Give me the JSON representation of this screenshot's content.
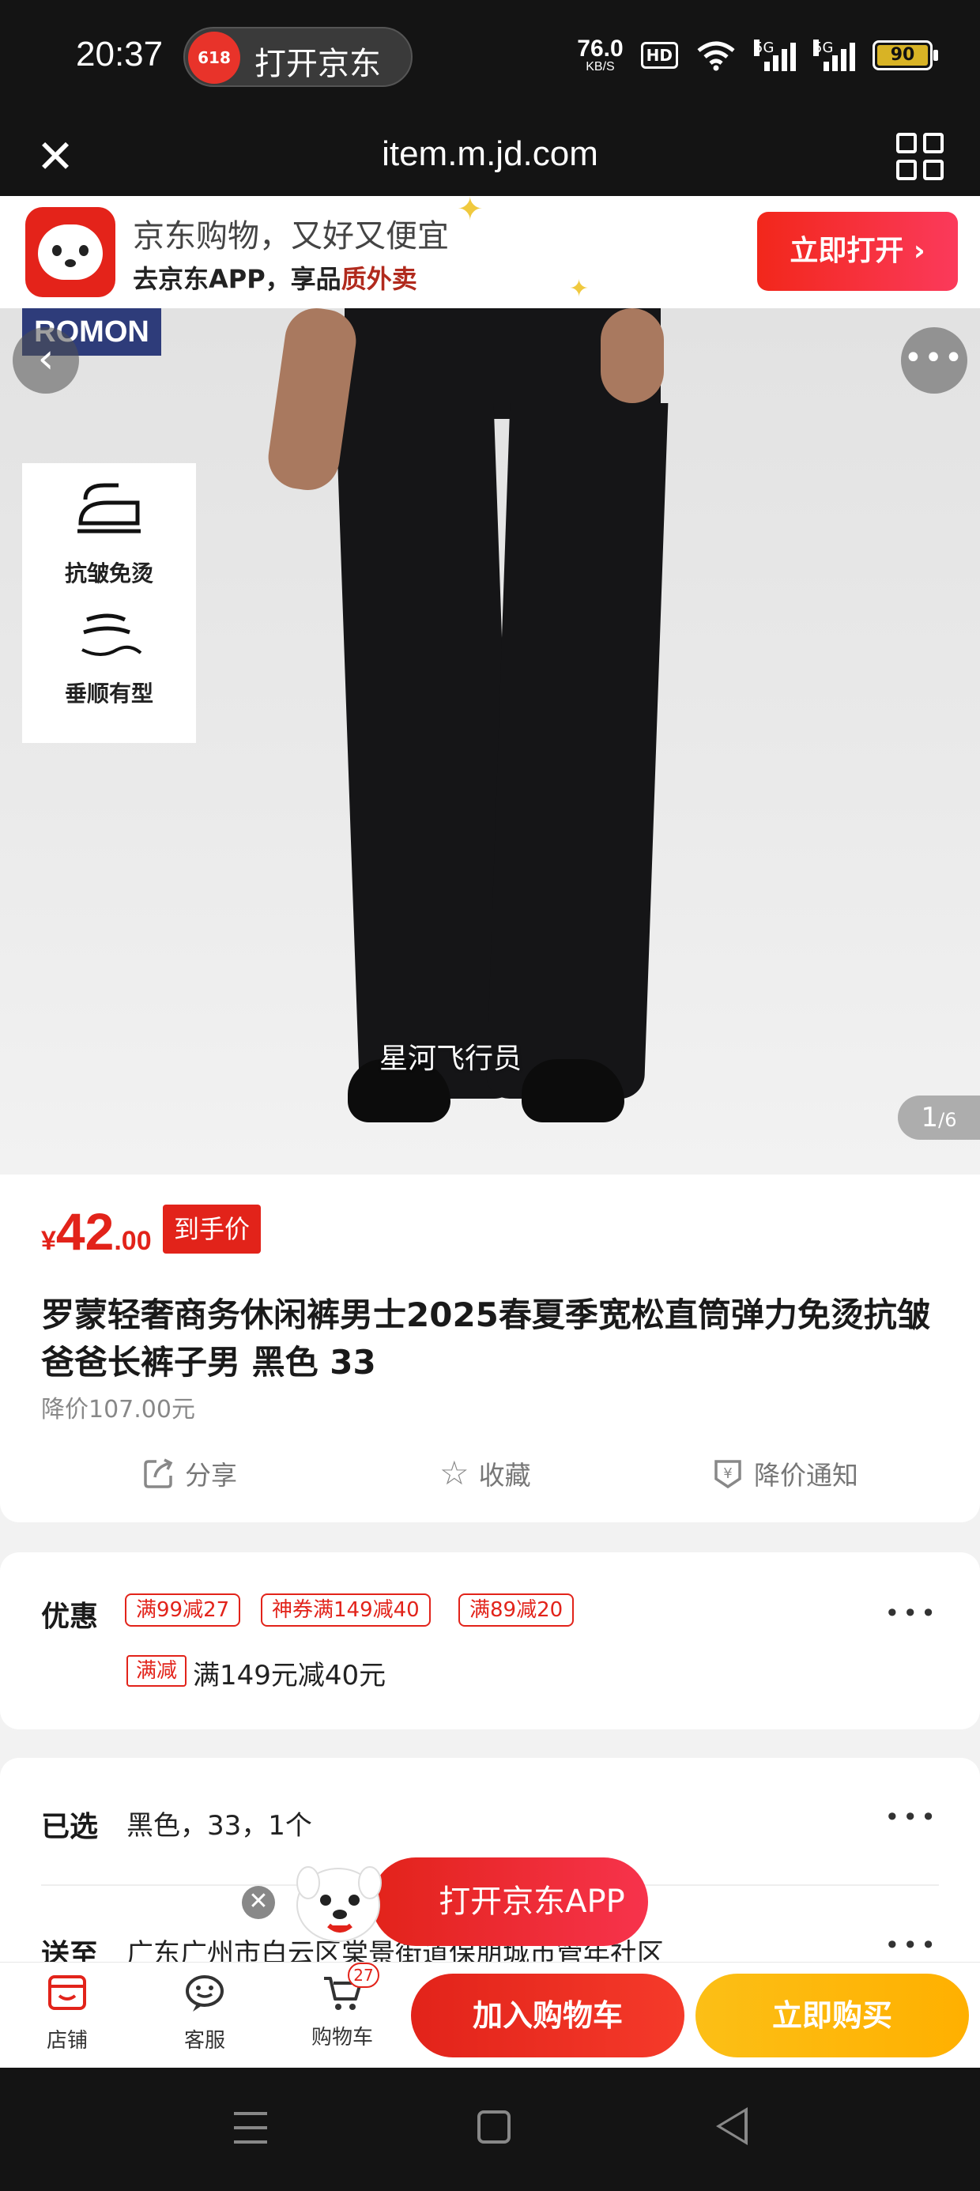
{
  "status_bar": {
    "time": "20:37",
    "pill_badge": "618",
    "pill_text": "打开京东",
    "net_speed": "76.0",
    "net_unit": "KB/S",
    "hd": "HD",
    "sig1_label": "5G",
    "sig2_label": "5G",
    "battery": "90"
  },
  "browser": {
    "url": "item.m.jd.com",
    "close_glyph": "✕"
  },
  "promo": {
    "line1": "京东购物，又好又便宜",
    "line2_prefix": "去京东APP，享品",
    "line2_highlight": "质外卖",
    "button": "立即打开 ›"
  },
  "hero": {
    "brand": "ROMON",
    "features": [
      "抗皱免烫",
      "垂顺有型"
    ],
    "watermark": "星河飞行员",
    "counter_current": "1",
    "counter_total": "/6",
    "back_glyph": "‹",
    "more_glyph": "•••",
    "colors": {
      "fabric": "#151517",
      "background": "#e6e6e6"
    }
  },
  "price": {
    "currency": "¥",
    "integer": "42",
    "decimal": ".00",
    "tag": "到手价",
    "color": "#e2231a"
  },
  "product": {
    "title": "罗蒙轻奢商务休闲裤男士2025春夏季宽松直筒弹力免烫抗皱爸爸长裤子男 黑色 33",
    "price_drop": "降价107.00元"
  },
  "actions": {
    "share": "分享",
    "favorite": "收藏",
    "notify": "降价通知"
  },
  "offers": {
    "label": "优惠",
    "chips": [
      "满99减27",
      "神券满149减40",
      "满89减20"
    ],
    "mini_tag": "满减",
    "detail": "满149元减40元",
    "more": "•••"
  },
  "selection": {
    "label": "已选",
    "value": "黑色，33，1个",
    "more": "•••"
  },
  "delivery": {
    "label": "送至",
    "value": "广东广州市白云区棠景街道保朋城市管年社区",
    "more": "•••"
  },
  "floating": {
    "button": "打开京东APP",
    "close": "✕"
  },
  "bottom_bar": {
    "store": "店铺",
    "service": "客服",
    "cart": "购物车",
    "cart_count": "27",
    "add_to_cart": "加入购物车",
    "buy_now": "立即购买",
    "accent": "#e2231a",
    "buy_color": "#ffb000"
  }
}
